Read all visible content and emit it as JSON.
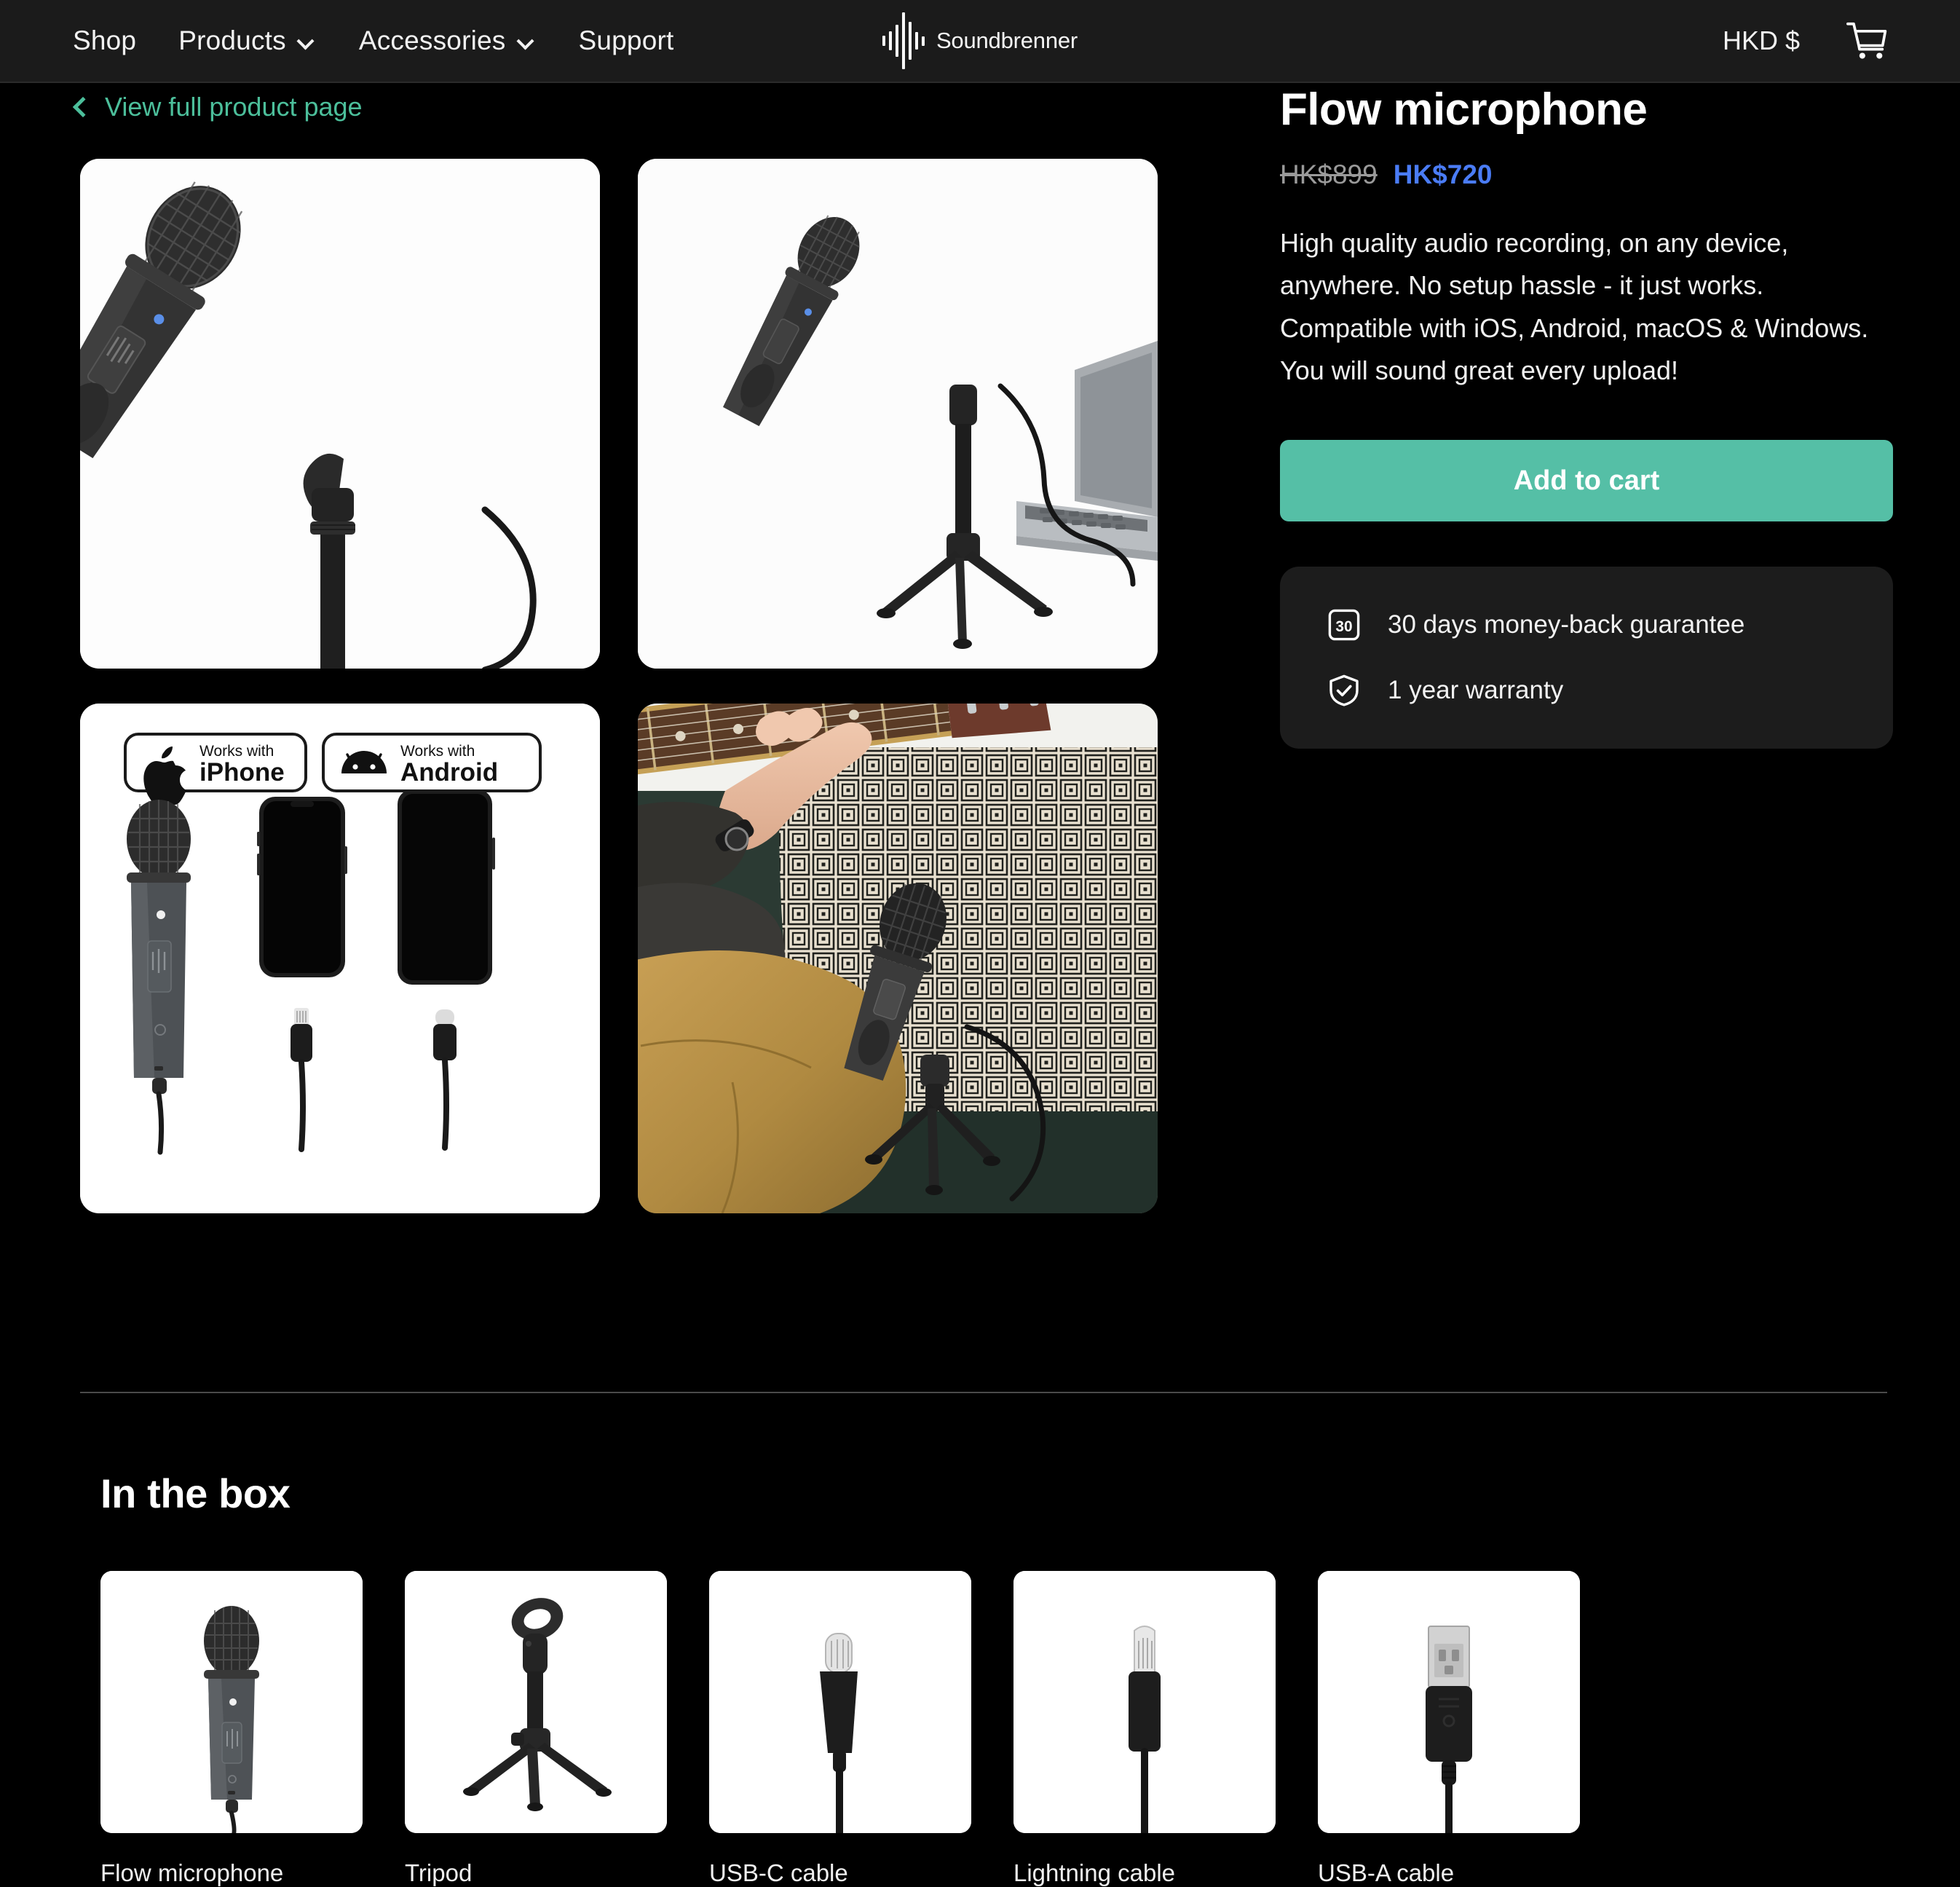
{
  "nav": {
    "links": [
      {
        "label": "Shop",
        "has_dropdown": false
      },
      {
        "label": "Products",
        "has_dropdown": true
      },
      {
        "label": "Accessories",
        "has_dropdown": true
      },
      {
        "label": "Support",
        "has_dropdown": false
      }
    ],
    "brand": "Soundbrenner",
    "currency": "HKD $",
    "cart_icon": "shopping-cart-icon"
  },
  "back_link": {
    "label": "View full product page",
    "icon": "chevron-left-icon",
    "color": "#4cbf9b"
  },
  "gallery": [
    {
      "alt": "Flow microphone on a mic stand, side view",
      "type": "product"
    },
    {
      "alt": "Flow microphone on tripod stand connected to a laptop",
      "type": "product"
    },
    {
      "alt": "Flow microphone with iPhone and Android phone, Lightning and USB-C cables",
      "type": "compat"
    },
    {
      "alt": "Person playing acoustic guitar on a couch with the Flow microphone on a tripod",
      "type": "photo"
    }
  ],
  "compat_badges": [
    {
      "prefix": "Works with",
      "name": "iPhone",
      "icon": "apple-icon"
    },
    {
      "prefix": "Works with",
      "name": "Android",
      "icon": "android-icon"
    }
  ],
  "product": {
    "title": "Flow microphone",
    "price_original": "HK$899",
    "price_sale": "HK$720",
    "price_sale_color": "#4a7cf6",
    "description": "High quality audio recording, on any device, anywhere. No setup hassle - it just works. Compatible with iOS, Android, macOS & Windows. You will sound great every upload!",
    "add_to_cart_label": "Add to cart",
    "add_to_cart_color": "#55bfa6",
    "guarantees": [
      {
        "label": "30 days money-back guarantee",
        "icon": "30-days-badge-icon"
      },
      {
        "label": "1 year warranty",
        "icon": "shield-check-icon"
      }
    ]
  },
  "in_the_box": {
    "heading": "In the box",
    "items": [
      {
        "label": "Flow microphone",
        "icon": "microphone-icon"
      },
      {
        "label": "Tripod",
        "icon": "tripod-stand-icon"
      },
      {
        "label": "USB-C cable",
        "icon": "usb-c-connector-icon"
      },
      {
        "label": "Lightning cable",
        "icon": "lightning-connector-icon"
      },
      {
        "label": "USB-A cable",
        "icon": "usb-a-connector-icon"
      }
    ]
  }
}
